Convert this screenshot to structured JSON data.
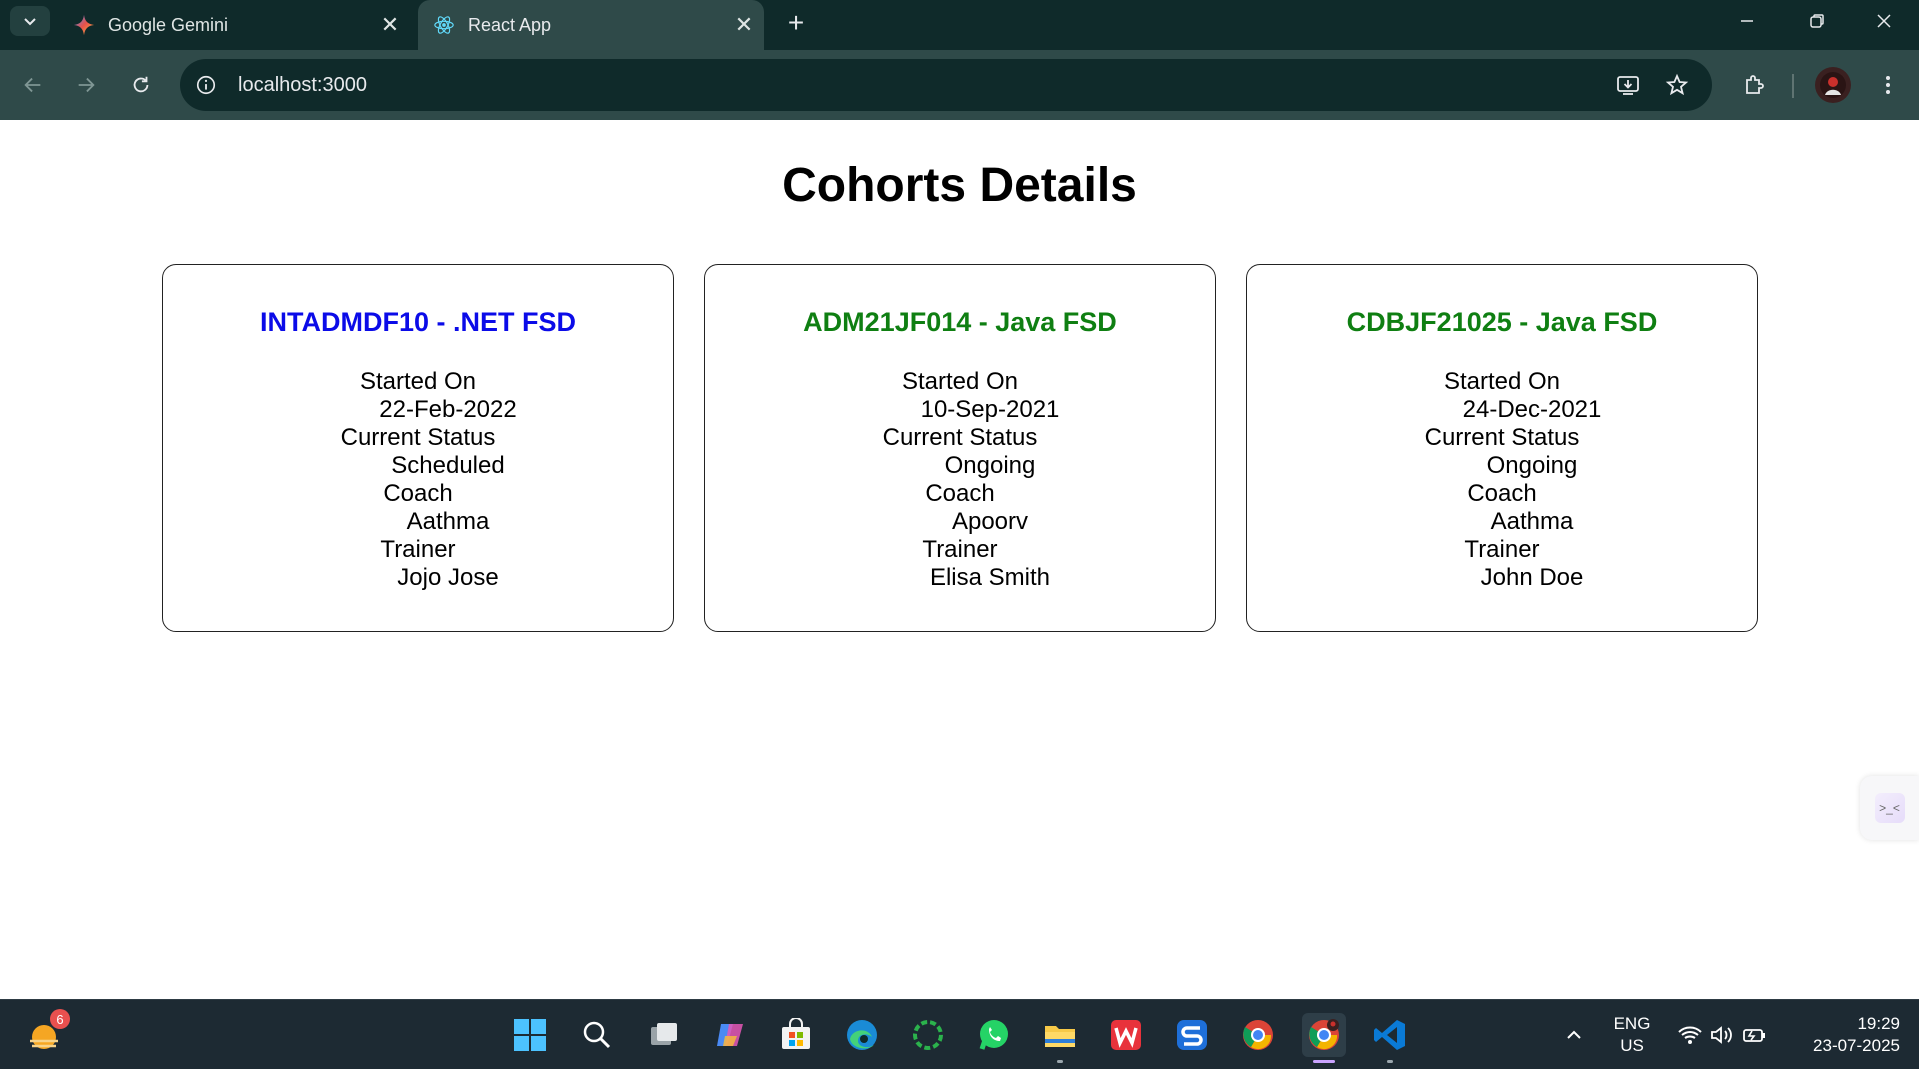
{
  "browser": {
    "tabs": [
      {
        "title": "Google Gemini",
        "icon": "gemini-icon",
        "active": false
      },
      {
        "title": "React App",
        "icon": "react-icon",
        "active": true
      }
    ],
    "url": "localhost:3000"
  },
  "page": {
    "title": "Cohorts Details",
    "cohorts": [
      {
        "heading": "INTADMDF10 - .NET FSD",
        "heading_color": "#0b0be8",
        "started_on_label": "Started On",
        "started_on": "22-Feb-2022",
        "status_label": "Current Status",
        "status": "Scheduled",
        "coach_label": "Coach",
        "coach": "Aathma",
        "trainer_label": "Trainer",
        "trainer": "Jojo Jose"
      },
      {
        "heading": "ADM21JF014 - Java FSD",
        "heading_color": "#0f7f12",
        "started_on_label": "Started On",
        "started_on": "10-Sep-2021",
        "status_label": "Current Status",
        "status": "Ongoing",
        "coach_label": "Coach",
        "coach": "Apoorv",
        "trainer_label": "Trainer",
        "trainer": "Elisa Smith"
      },
      {
        "heading": "CDBJF21025 - Java FSD",
        "heading_color": "#0f7f12",
        "started_on_label": "Started On",
        "started_on": "24-Dec-2021",
        "status_label": "Current Status",
        "status": "Ongoing",
        "coach_label": "Coach",
        "coach": "Aathma",
        "trainer_label": "Trainer",
        "trainer": "John Doe"
      }
    ]
  },
  "taskbar": {
    "weather_badge": "6",
    "language_line1": "ENG",
    "language_line2": "US",
    "time": "19:29",
    "date": "23-07-2025"
  }
}
